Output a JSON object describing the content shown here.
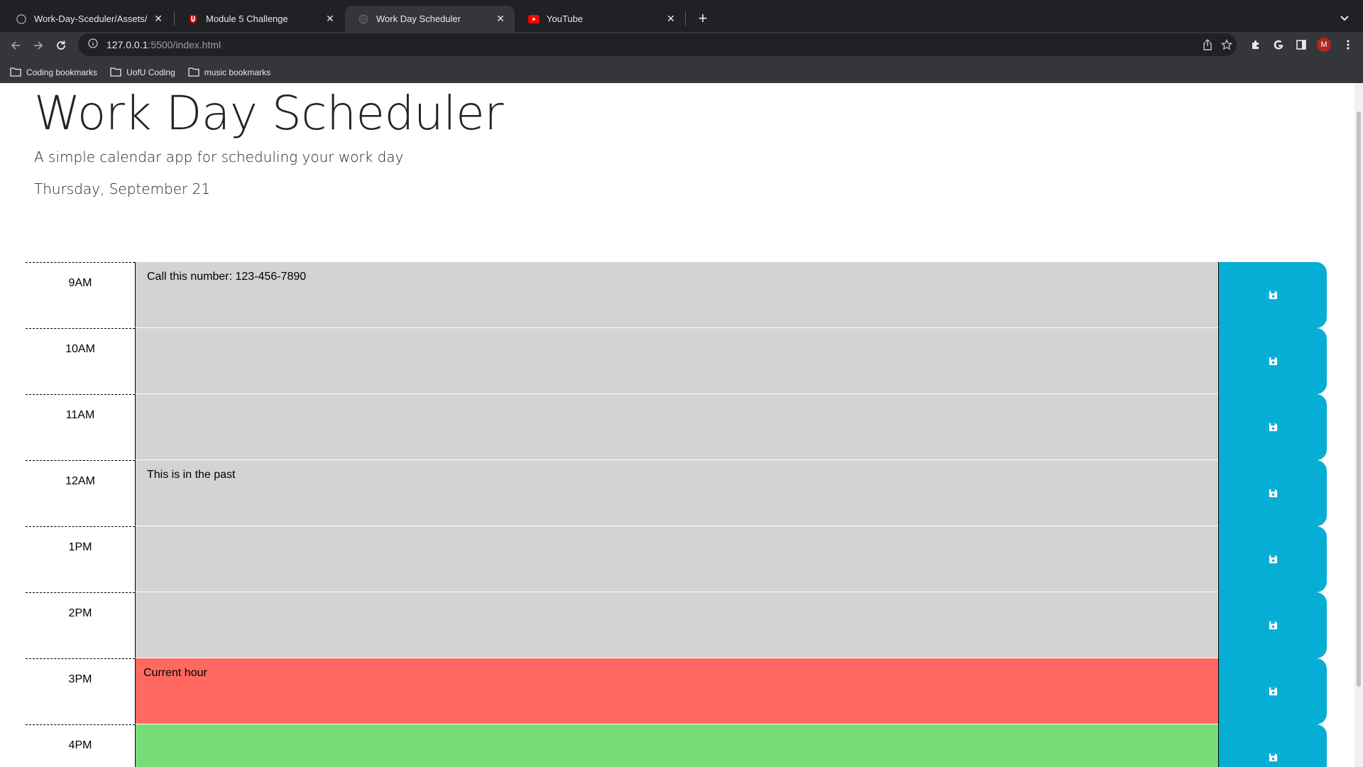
{
  "browser": {
    "tabs": [
      {
        "title": "Work-Day-Sceduler/Assets/sc",
        "icon": "github-icon",
        "active": false
      },
      {
        "title": "Module 5 Challenge",
        "icon": "utah-u-icon",
        "active": false
      },
      {
        "title": "Work Day Scheduler",
        "icon": "globe-icon",
        "active": true
      },
      {
        "title": "YouTube",
        "icon": "youtube-icon",
        "active": false
      }
    ],
    "url_host": "127.0.0.1",
    "url_path": ":5500/index.html",
    "avatar_letter": "M",
    "bookmarks": [
      "Coding bookmarks",
      "UofU Coding",
      "music bookmarks"
    ]
  },
  "header": {
    "title": "Work Day Scheduler",
    "lead": "A simple calendar app for scheduling your work day",
    "current_day": "Thursday, September 21"
  },
  "time_blocks": [
    {
      "hour": "9AM",
      "text": "Call this number: 123-456-7890",
      "state": "past"
    },
    {
      "hour": "10AM",
      "text": "",
      "state": "past"
    },
    {
      "hour": "11AM",
      "text": "",
      "state": "past"
    },
    {
      "hour": "12AM",
      "text": "This is in the past",
      "state": "past"
    },
    {
      "hour": "1PM",
      "text": "",
      "state": "past"
    },
    {
      "hour": "2PM",
      "text": "",
      "state": "past"
    },
    {
      "hour": "3PM",
      "text": "Current hour",
      "state": "present"
    },
    {
      "hour": "4PM",
      "text": "",
      "state": "future"
    }
  ],
  "colors": {
    "past": "#d3d3d3",
    "present": "#ff6961",
    "future": "#77dd77",
    "save_button": "#06aed5"
  }
}
